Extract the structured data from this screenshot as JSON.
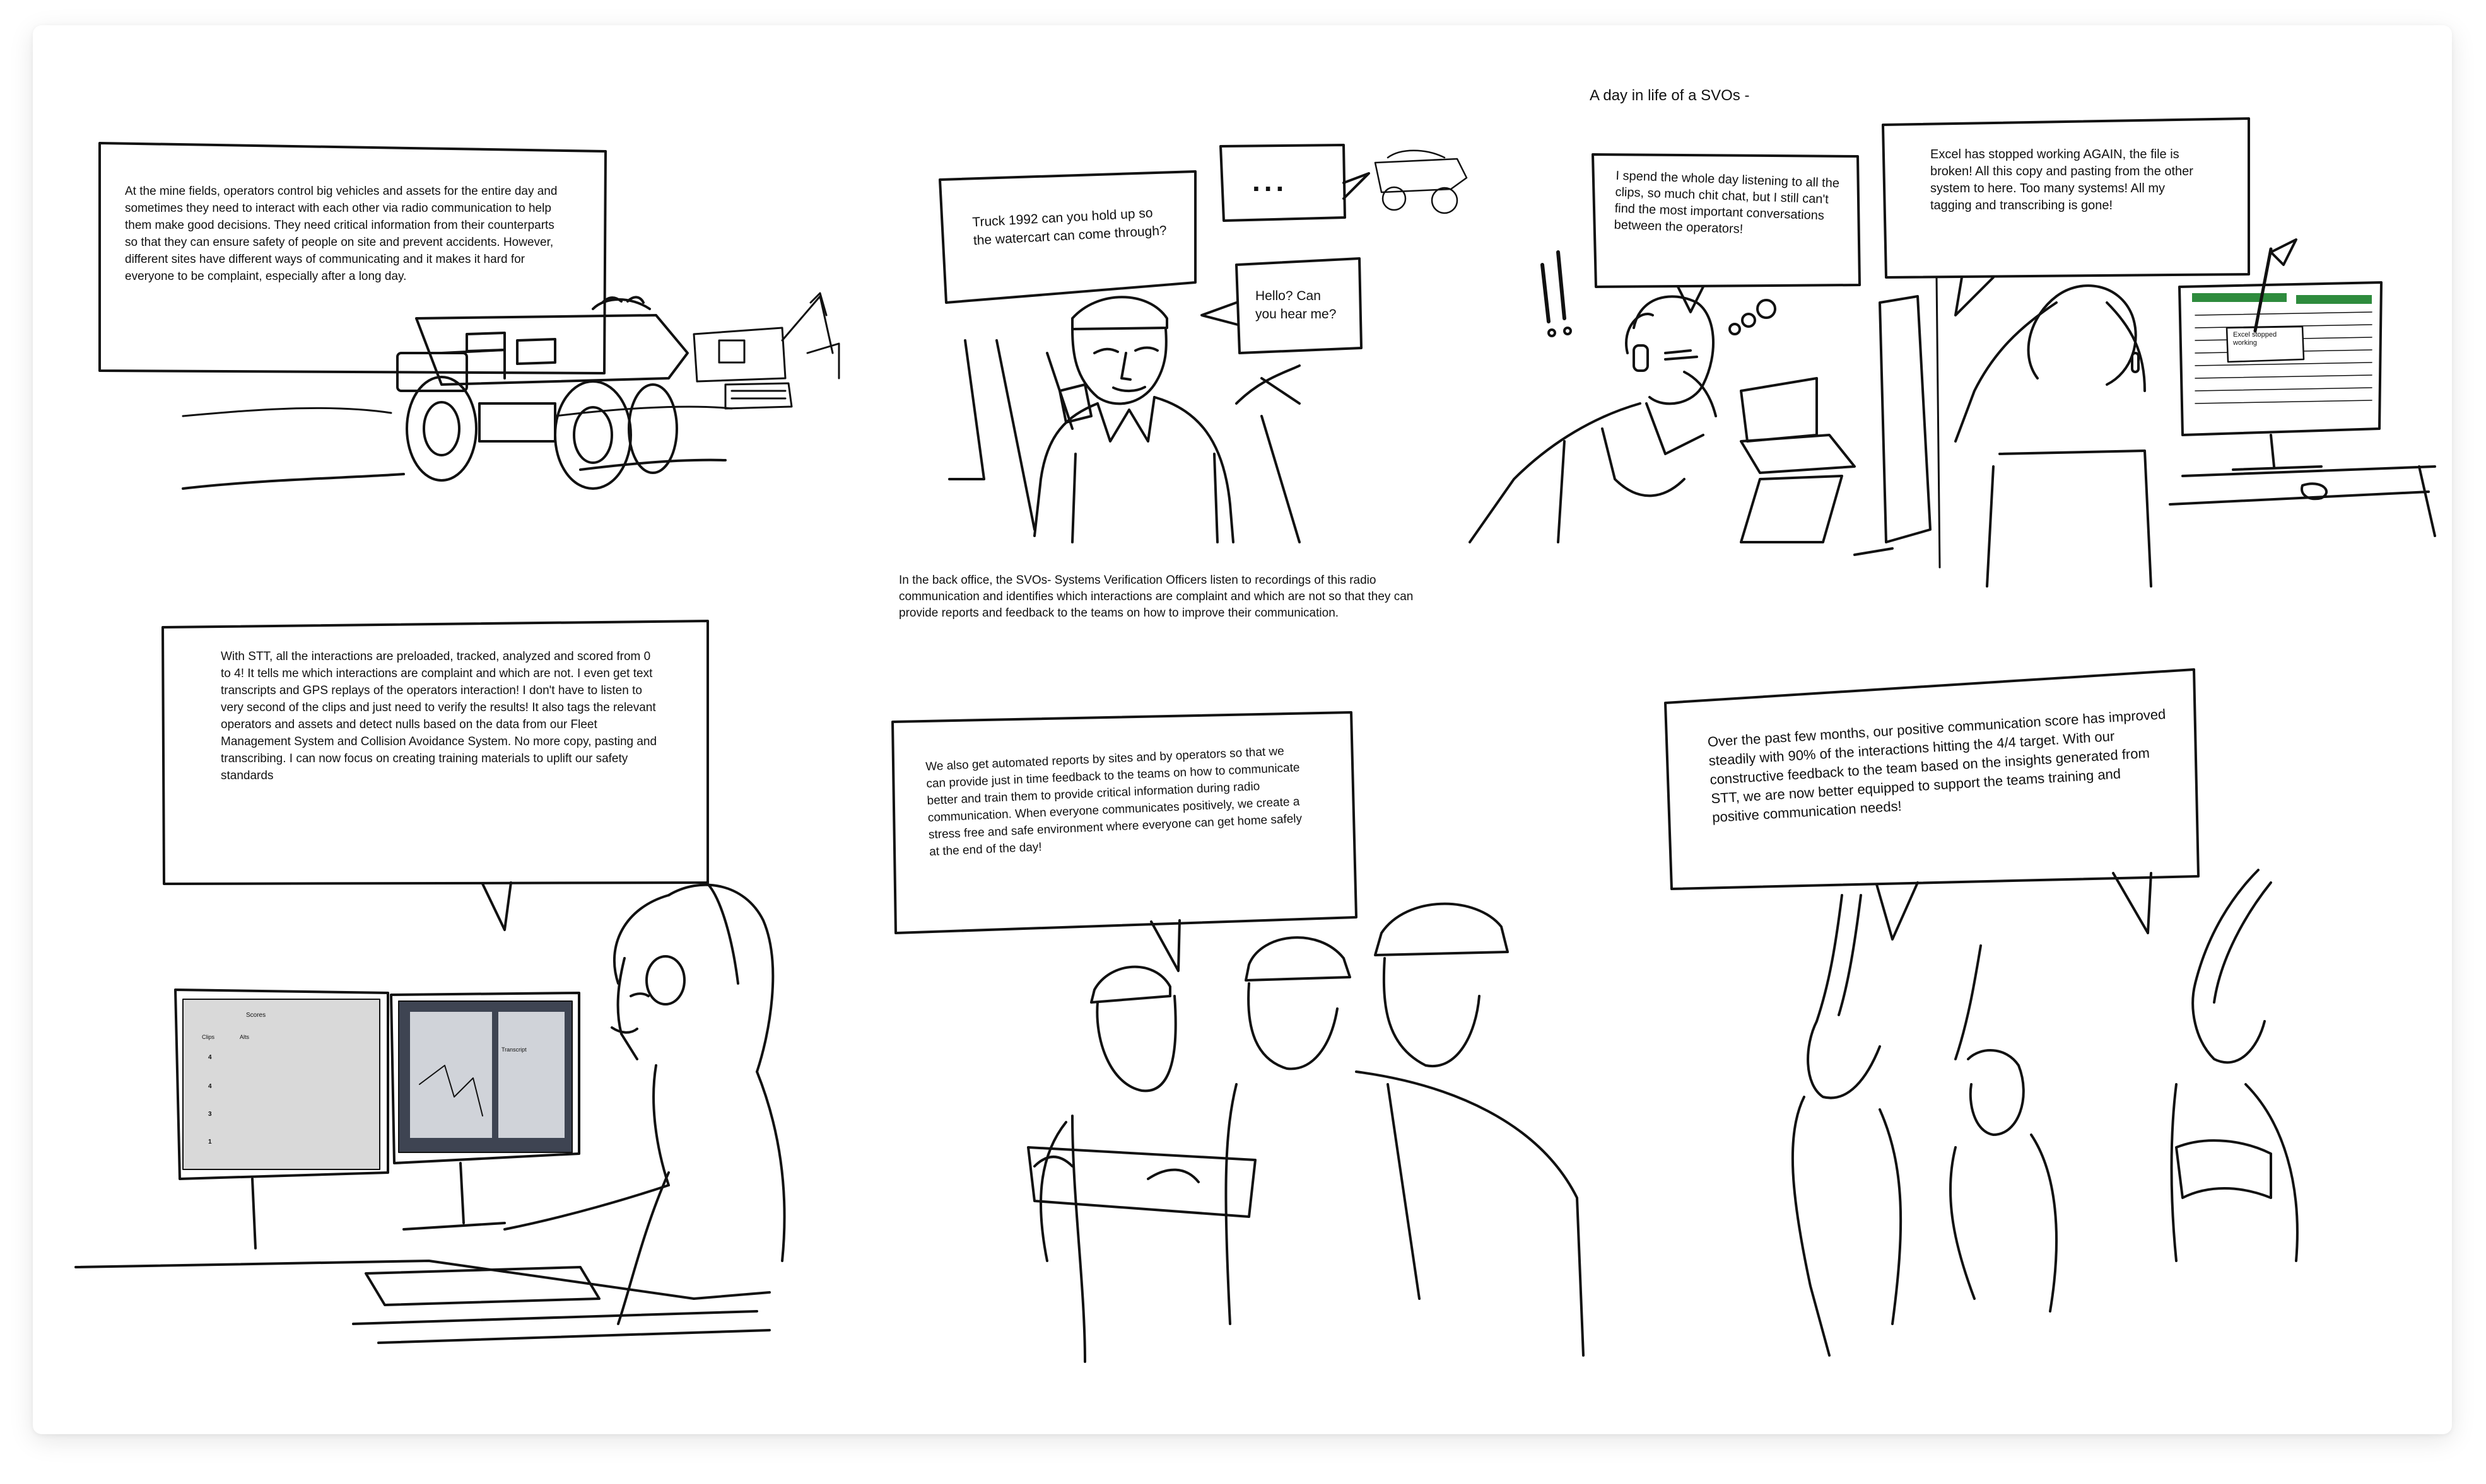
{
  "header": {
    "title": "A day in life of a SVOs -"
  },
  "panel1": {
    "caption": "At the mine fields, operators control big vehicles and assets for the entire day and sometimes they need to interact with each other via radio communication to help them make good decisions. They need critical information from their counterparts so that they can ensure safety of people on site and prevent accidents. However, different sites have different ways of communicating and it makes it hard for everyone to be complaint, especially after a long day."
  },
  "panel2": {
    "bubble_truck": "Truck 1992 can you hold up so the watercart can come through?",
    "bubble_dots": "...",
    "bubble_hello": "Hello? Can you hear me?",
    "caption": "In the back office, the SVOs- Systems Verification Officers listen to recordings of this radio communication and identifies which interactions are complaint and which are not so that they can provide reports and feedback to the teams on how to improve their communication."
  },
  "panel3": {
    "bubble_listen": "I spend the whole day listening to all the clips, so much chit chat, but I still can't find the most important conversations between the operators!",
    "bubble_excel": "Excel has stopped working AGAIN, the file is broken!  All this copy and pasting from the other system to here. Too many systems! All my tagging and transcribing is gone!",
    "exclaim": "!!",
    "screen_dialog": "Excel stopped working"
  },
  "panel4": {
    "bubble": "With STT, all the interactions are preloaded, tracked, analyzed and scored from 0 to 4! It tells me which interactions are complaint and which are not. I even get text transcripts and GPS replays of the operators interaction! I don't have to listen to very second of the clips and just need to verify the results! It also tags the relevant operators and assets and detect nulls based on the data from our Fleet Management System and Collision Avoidance System. No more copy, pasting and transcribing. I can now focus on creating training materials to uplift our safety standards",
    "screen_left": {
      "title": "Scores",
      "tabs": [
        "Clips",
        "Alts"
      ],
      "row_numbers": [
        "4",
        "4",
        "3",
        "1"
      ]
    },
    "screen_right": {
      "title": "Transcript"
    }
  },
  "panel5": {
    "bubble": "We also get automated reports by sites and by operators so that we can provide just in time feedback to the teams on how to communicate better and train them to provide critical information during radio communication. When everyone communicates positively, we create a stress free and safe environment where everyone can get home safely at the end of the day!"
  },
  "panel6": {
    "bubble": "Over the past few months, our positive communication score has improved steadily with 90% of the interactions hitting the 4/4 target. With our constructive feedback to the team based on the insights generated from STT, we are now better equipped to support the teams  training and positive communication needs!"
  }
}
